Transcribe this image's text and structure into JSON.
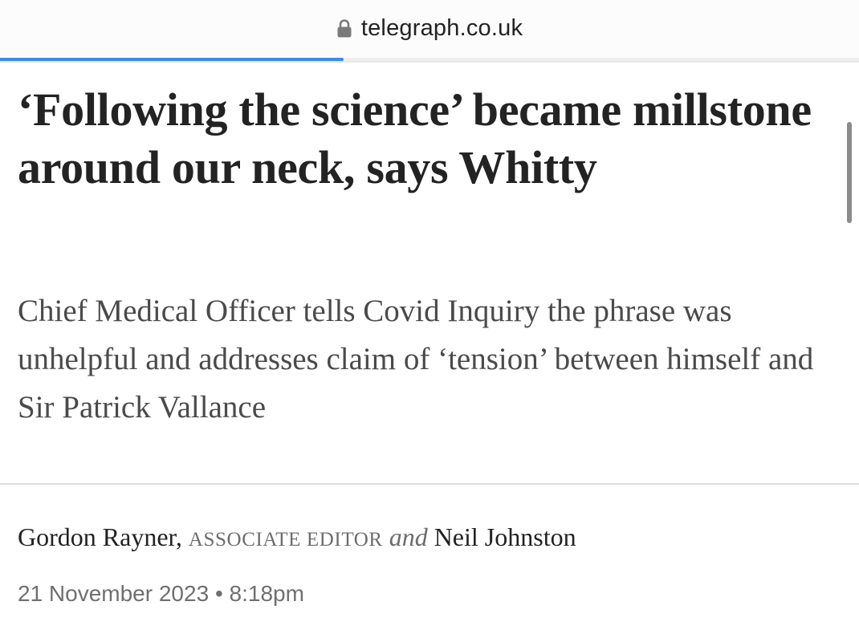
{
  "browser": {
    "url": "telegraph.co.uk",
    "lock_icon": "lock-icon",
    "load_progress": 0.4,
    "accent_color": "#3e8ae8"
  },
  "article": {
    "headline": "‘Following the science’ became millstone around our neck, says Whitty",
    "standfirst": "Chief Medical Officer tells Covid Inquiry the phrase was unhelpful and addresses claim of ‘tension’ between himself and Sir Patrick Vallance",
    "byline": {
      "author1": "Gordon Rayner",
      "separator": ",",
      "author1_role": "ASSOCIATE EDITOR",
      "conjunction": "and",
      "author2": "Neil Johnston"
    },
    "date": "21 November 2023",
    "date_separator": "•",
    "time": "8:18pm"
  }
}
